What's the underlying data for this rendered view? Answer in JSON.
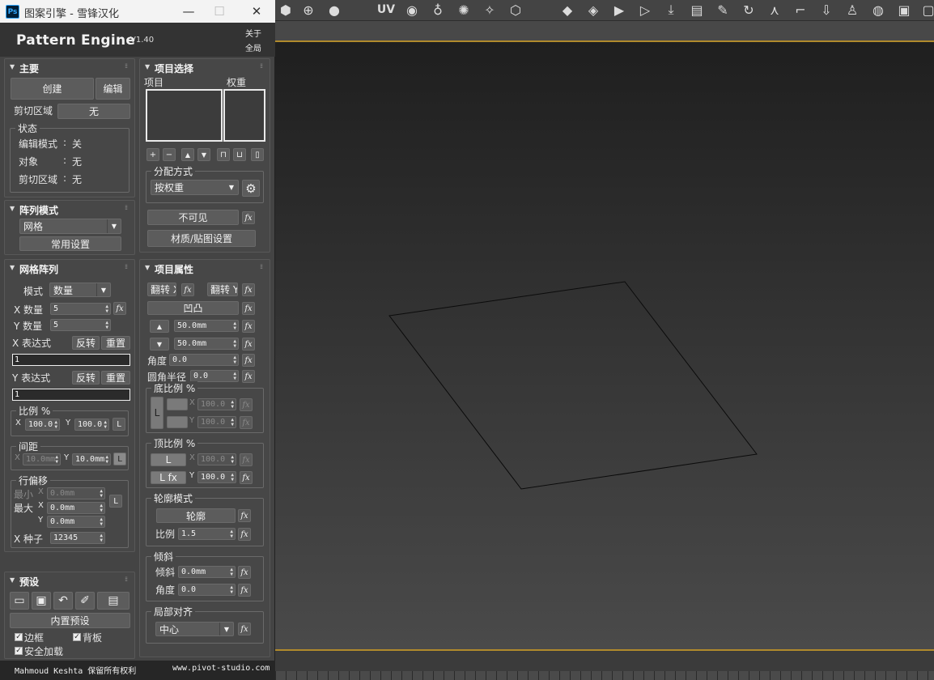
{
  "window": {
    "title": "图案引擎 - 雪锋汉化",
    "app_name": "Pattern Engine",
    "version": "V1.40",
    "about": "关于",
    "global": "全局"
  },
  "footer": {
    "author": "Mahmoud Keshta 保留所有权利",
    "site": "www.pivot-studio.com"
  },
  "viewport": {
    "toolbar_icons": [
      "shield-icon",
      "target-icon",
      "sphere-icon",
      "uv-label",
      "eye-icon",
      "bulb-icon",
      "sun-icon",
      "spot-icon",
      "cube-icon",
      "box-icon",
      "box-add-icon",
      "camera-icon",
      "camera-add-icon",
      "download-icon",
      "archive-icon",
      "pen-icon",
      "refresh-icon",
      "axis-icon",
      "corner-icon",
      "down-icon",
      "pin-icon",
      "sphere-check-icon",
      "cube2-icon",
      "cube3-icon"
    ],
    "uv_text": "UV",
    "plane_shape": [
      [
        481,
        388
      ],
      [
        772,
        346
      ],
      [
        935,
        559
      ],
      [
        644,
        602
      ]
    ]
  },
  "main": {
    "title": "主要",
    "create": "创建",
    "edit": "编辑",
    "clip_label": "剪切区域",
    "clip_value": "无",
    "status": {
      "title": "状态",
      "edit_mode_label": "编辑模式",
      "edit_mode_value": "关",
      "object_label": "对象",
      "object_value": "无",
      "clip_label": "剪切区域",
      "clip_value": "无",
      "sep": ":"
    }
  },
  "array_mode": {
    "title": "阵列模式",
    "value": "网格",
    "common": "常用设置"
  },
  "grid_array": {
    "title": "网格阵列",
    "mode_label": "模式",
    "mode_value": "数量",
    "x_count_label": "X 数量",
    "x_count": "5",
    "y_count_label": "Y 数量",
    "y_count": "5",
    "x_expr_label": "X 表达式",
    "y_expr_label": "Y 表达式",
    "invert": "反转",
    "reset": "重置",
    "x_expr": "1",
    "y_expr": "1",
    "scale": {
      "title": "比例 %",
      "x_label": "X",
      "x": "100.0",
      "y_label": "Y",
      "y": "100.0",
      "lock": "L"
    },
    "spacing": {
      "title": "间距",
      "x_label": "X",
      "x": "10.0mm",
      "y_label": "Y",
      "y": "10.0mm",
      "lock": "L"
    },
    "row_offset": {
      "title": "行偏移",
      "min_label": "最小",
      "max_label": "最大",
      "x_label": "X",
      "y_label": "Y",
      "min_x": "0.0mm",
      "max_x": "0.0mm",
      "max_y": "0.0mm",
      "lock": "L"
    },
    "seed_label": "X 种子",
    "seed": "12345"
  },
  "presets": {
    "title": "预设",
    "builtin": "内置预设",
    "border": "边框",
    "backboard": "背板",
    "safe_load": "安全加载"
  },
  "item_select": {
    "title": "项目选择",
    "items_label": "项目",
    "weight_label": "权重",
    "dist": {
      "title": "分配方式",
      "value": "按权重"
    },
    "invisible": "不可见",
    "material": "材质/贴图设置"
  },
  "item_props": {
    "title": "项目属性",
    "flip_x": "翻转 X",
    "flip_y": "翻转 Y",
    "bump": "凹凸",
    "val_up": "50.0mm",
    "val_down": "50.0mm",
    "angle_label": "角度",
    "angle": "0.0",
    "fillet_label": "圆角半径",
    "fillet": "0.0",
    "bottom_scale": {
      "title": "底比例 %",
      "lock": "L",
      "x_label": "X",
      "x": "100.0",
      "y_label": "Y",
      "y": "100.0"
    },
    "top_scale": {
      "title": "顶比例 %",
      "lock": "L",
      "lock_fx": "L fx",
      "x_label": "X",
      "x": "100.0",
      "y_label": "Y",
      "y": "100.0"
    },
    "outline": {
      "title": "轮廓模式",
      "button": "轮廓",
      "scale_label": "比例",
      "scale": "1.5"
    },
    "tilt": {
      "title": "倾斜",
      "tilt_label": "倾斜",
      "tilt": "0.0mm",
      "angle_label": "角度",
      "angle": "0.0"
    },
    "align": {
      "title": "局部对齐",
      "value": "中心"
    }
  },
  "fx": "fx",
  "colors": {
    "accent_line": "#b08a2c",
    "panel": "#474747",
    "bg": "#444444"
  }
}
